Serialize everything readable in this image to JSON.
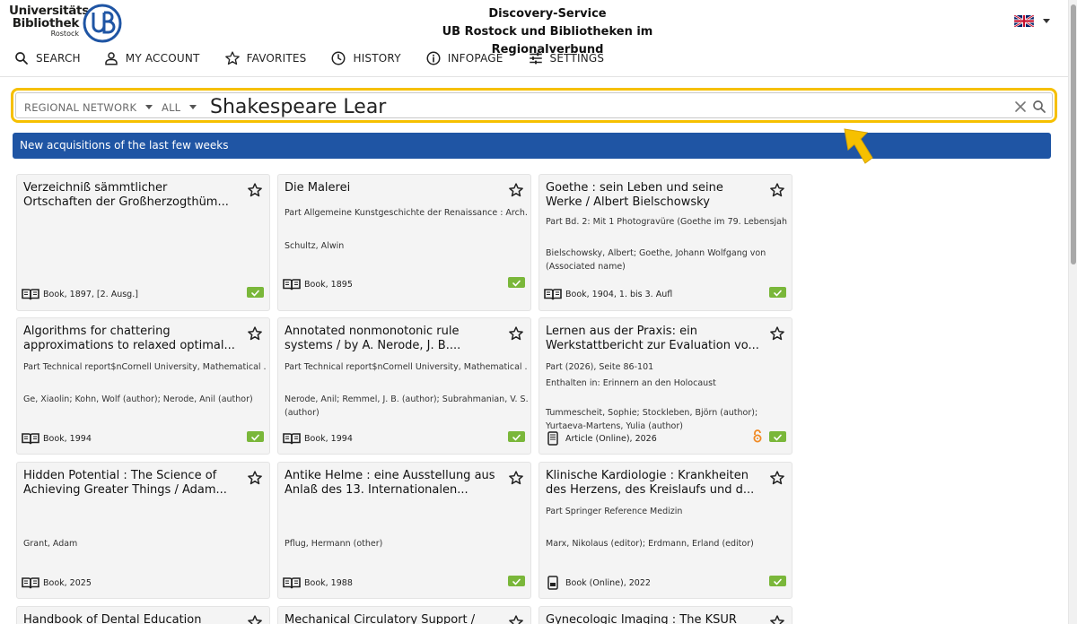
{
  "logo": {
    "line1": "Universitäts",
    "line2": "Bibliothek",
    "line3": "Rostock",
    "mark": "UB"
  },
  "header": {
    "title_line1": "Discovery-Service",
    "title_line2": "UB Rostock und Bibliotheken im Regionalverbund"
  },
  "language": {
    "icon": "uk-flag-icon"
  },
  "nav": [
    {
      "label": "SEARCH",
      "icon": "search-icon"
    },
    {
      "label": "MY ACCOUNT",
      "icon": "user-icon"
    },
    {
      "label": "FAVORITES",
      "icon": "star-icon"
    },
    {
      "label": "HISTORY",
      "icon": "clock-icon"
    },
    {
      "label": "INFOPAGE",
      "icon": "info-icon"
    },
    {
      "label": "SETTINGS",
      "icon": "sliders-icon"
    }
  ],
  "search": {
    "scope": "REGIONAL NETWORK",
    "field": "ALL",
    "query": "Shakespeare Lear"
  },
  "banner": "New acquisitions of the last few weeks",
  "colors": {
    "accent": "#f6c000",
    "banner": "#1f55a4",
    "available": "#7ab73a",
    "open_access": "#f08a24"
  },
  "cards": [
    {
      "title": [
        "Verzeichniß sämmtlicher",
        "Ortschaften der Großherzogthüm..."
      ],
      "part": "",
      "sub": "",
      "authors": "",
      "type": "Book, 1897, [2. Ausg.]",
      "type_icon": "book-icon",
      "available": true,
      "open_access": false
    },
    {
      "title": [
        "Die Malerei"
      ],
      "part": "Part Allgemeine Kunstgeschichte der Renaissance : Arch...",
      "sub": "",
      "authors": "Schultz, Alwin",
      "type": "Book, 1895",
      "type_icon": "book-icon",
      "available": true,
      "open_access": false
    },
    {
      "title": [
        "Goethe : sein Leben und seine",
        "Werke / Albert Bielschowsky"
      ],
      "part": "Part Bd. 2: Mit 1 Photogravüre (Goethe im 79. Lebensjah...",
      "sub": "",
      "authors": "Bielschowsky, Albert;  Goethe, Johann Wolfgang von (Associated name)",
      "type": "Book, 1904, 1. bis 3. Aufl",
      "type_icon": "book-icon",
      "available": true,
      "open_access": false
    },
    {
      "title": [
        "Algorithms for chattering",
        "approximations to relaxed optimal..."
      ],
      "part": "Part Technical report$nCornell University, Mathematical ...",
      "sub": "",
      "authors": "Ge, Xiaolin;  Kohn, Wolf (author);  Nerode, Anil (author)",
      "type": "Book, 1994",
      "type_icon": "book-icon",
      "available": true,
      "open_access": false
    },
    {
      "title": [
        "Annotated nonmonotonic rule",
        "systems / by A. Nerode, J. B...."
      ],
      "part": "Part Technical report$nCornell University, Mathematical ...",
      "sub": "",
      "authors": "Nerode, Anil;  Remmel, J. B. (author);  Subrahmanian, V. S. (author)",
      "type": "Book, 1994",
      "type_icon": "book-icon",
      "available": true,
      "open_access": false
    },
    {
      "title": [
        "Lernen aus der Praxis: ein",
        "Werkstattbericht zur Evaluation vo..."
      ],
      "part": "Part (2026), Seite 86-101",
      "sub": "Enthalten in: Erinnern an den Holocaust",
      "authors": "Tummescheit, Sophie;  Stockleben, Björn (author);  Yurtaeva-Martens, Yulia (author)",
      "type": "Article (Online), 2026",
      "type_icon": "article-online-icon",
      "available": true,
      "open_access": true
    },
    {
      "title": [
        "Hidden Potential : The Science of",
        "Achieving Greater Things / Adam..."
      ],
      "part": "",
      "sub": "",
      "authors": "Grant, Adam",
      "type": "Book, 2025",
      "type_icon": "book-icon",
      "available": false,
      "open_access": false
    },
    {
      "title": [
        "Antike Helme : eine Ausstellung aus",
        "Anlaß des 13. Internationalen..."
      ],
      "part": "",
      "sub": "",
      "authors": "Pflug, Hermann (other)",
      "type": "Book, 1988",
      "type_icon": "book-icon",
      "available": true,
      "open_access": false
    },
    {
      "title": [
        "Klinische Kardiologie : Krankheiten",
        "des Herzens, des Kreislaufs und d..."
      ],
      "part": "Part Springer Reference Medizin",
      "sub": "",
      "authors": "Marx, Nikolaus (editor);  Erdmann, Erland (editor)",
      "type": "Book (Online), 2022",
      "type_icon": "ebook-icon",
      "available": true,
      "open_access": false
    },
    {
      "title": [
        "Handbook of Dental Education"
      ],
      "part": "",
      "sub": "",
      "authors": "",
      "type": "",
      "type_icon": "",
      "available": false,
      "open_access": false
    },
    {
      "title": [
        "Mechanical Circulatory Support /"
      ],
      "part": "",
      "sub": "",
      "authors": "",
      "type": "",
      "type_icon": "",
      "available": false,
      "open_access": false
    },
    {
      "title": [
        "Gynecologic Imaging : The KSUR"
      ],
      "part": "",
      "sub": "",
      "authors": "",
      "type": "",
      "type_icon": "",
      "available": false,
      "open_access": false
    }
  ]
}
